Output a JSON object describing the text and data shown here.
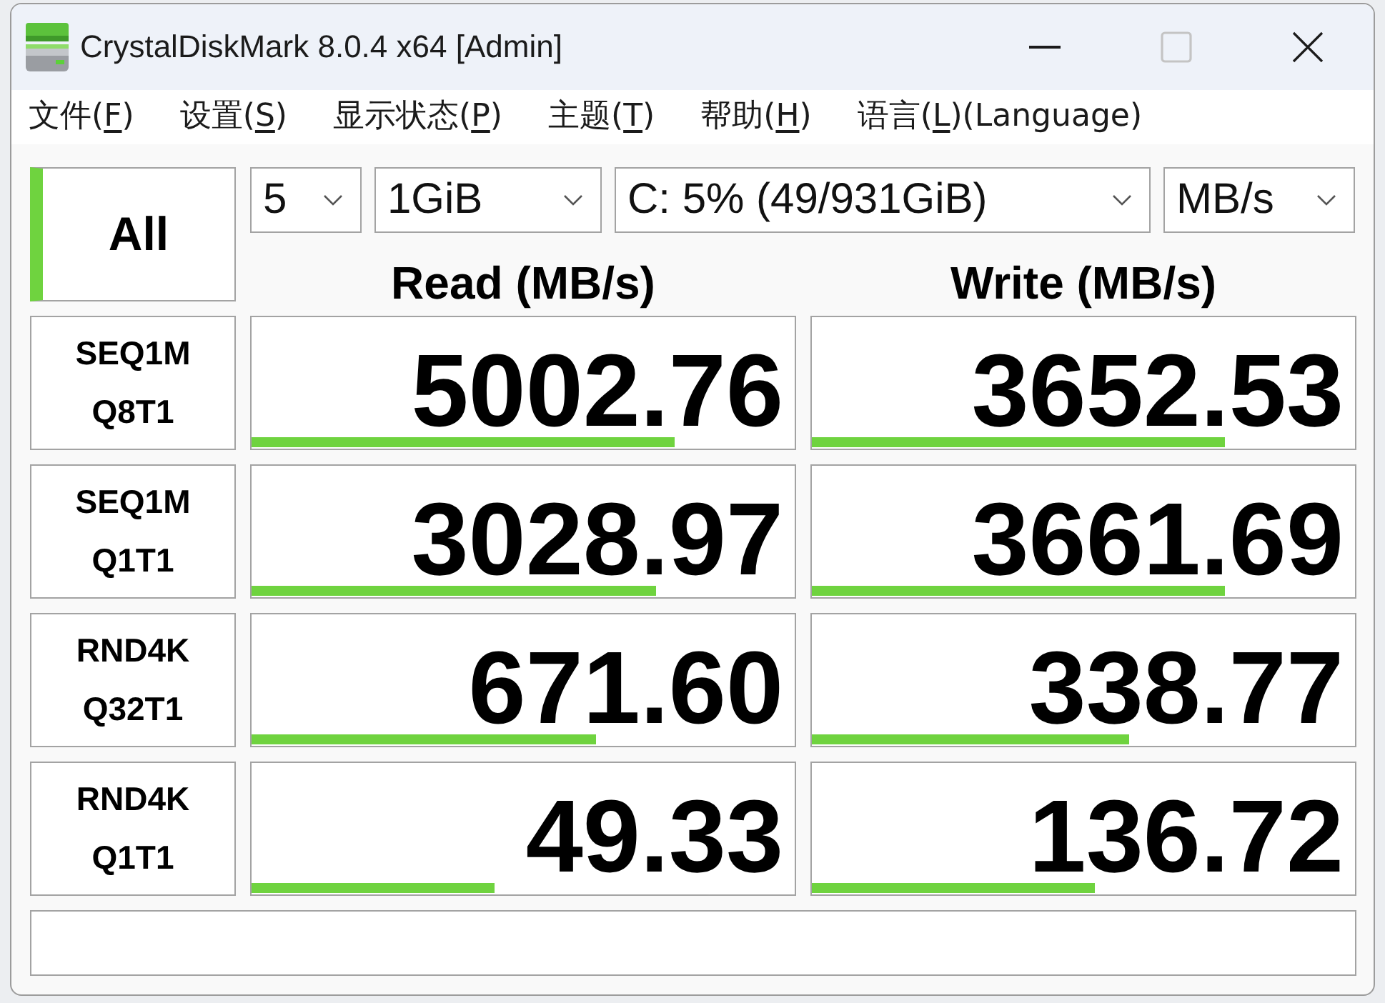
{
  "window": {
    "title": "CrystalDiskMark 8.0.4 x64 [Admin]",
    "controls": [
      {
        "kind": "minimize",
        "disabled": false
      },
      {
        "kind": "maximize",
        "disabled": true
      },
      {
        "kind": "close",
        "disabled": false
      }
    ]
  },
  "menu": [
    {
      "label": [
        {
          "text": "文件(",
          "underline": false
        },
        {
          "text": "F",
          "underline": true
        },
        {
          "text": ")",
          "underline": false
        }
      ]
    },
    {
      "label": [
        {
          "text": "设置(",
          "underline": false
        },
        {
          "text": "S",
          "underline": true
        },
        {
          "text": ")",
          "underline": false
        }
      ]
    },
    {
      "label": [
        {
          "text": "显示状态(",
          "underline": false
        },
        {
          "text": "P",
          "underline": true
        },
        {
          "text": ")",
          "underline": false
        }
      ]
    },
    {
      "label": [
        {
          "text": "主题(",
          "underline": false
        },
        {
          "text": "T",
          "underline": true
        },
        {
          "text": ")",
          "underline": false
        }
      ]
    },
    {
      "label": [
        {
          "text": "帮助(",
          "underline": false
        },
        {
          "text": "H",
          "underline": true
        },
        {
          "text": ")",
          "underline": false
        }
      ]
    },
    {
      "label": [
        {
          "text": "语言(",
          "underline": false
        },
        {
          "text": "L",
          "underline": true
        },
        {
          "text": ")(Language)",
          "underline": false
        }
      ]
    }
  ],
  "all_button": {
    "label": "All"
  },
  "dropdowns": [
    {
      "value": "5"
    },
    {
      "value": "1GiB"
    },
    {
      "value": "C: 5% (49/931GiB)"
    },
    {
      "value": "MB/s"
    }
  ],
  "columns": [
    "Read (MB/s)",
    "Write (MB/s)"
  ],
  "tests": [
    {
      "name": "SEQ1M",
      "params": "Q8T1",
      "read": {
        "value": "5002.76",
        "level": 0.78
      },
      "write": {
        "value": "3652.53",
        "level": 0.76
      }
    },
    {
      "name": "SEQ1M",
      "params": "Q1T1",
      "read": {
        "value": "3028.97",
        "level": 0.745
      },
      "write": {
        "value": "3661.69",
        "level": 0.76
      }
    },
    {
      "name": "RND4K",
      "params": "Q32T1",
      "read": {
        "value": "671.60",
        "level": 0.635
      },
      "write": {
        "value": "338.77",
        "level": 0.585
      }
    },
    {
      "name": "RND4K",
      "params": "Q1T1",
      "read": {
        "value": "49.33",
        "level": 0.448
      },
      "write": {
        "value": "136.72",
        "level": 0.52
      }
    }
  ]
}
